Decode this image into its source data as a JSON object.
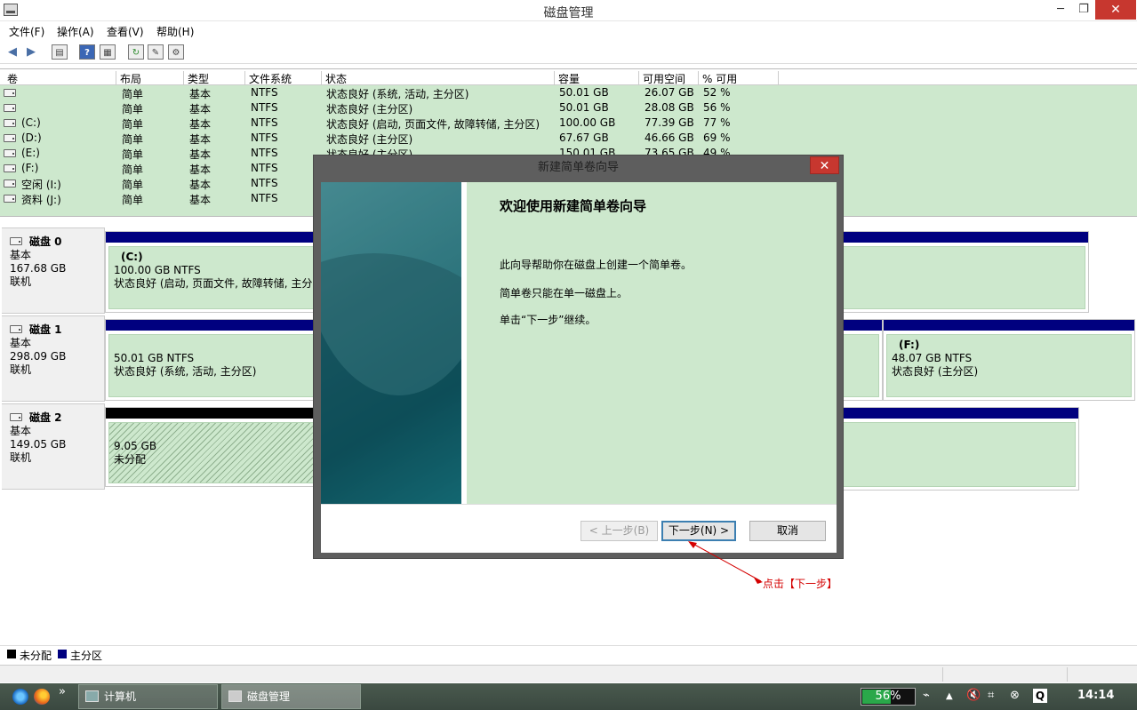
{
  "window": {
    "title": "磁盘管理",
    "min": "─",
    "max": "❐",
    "close": "✕"
  },
  "menu": [
    "文件(F)",
    "操作(A)",
    "查看(V)",
    "帮助(H)"
  ],
  "toolbar_icons": [
    "back-icon",
    "forward-icon",
    "properties-icon",
    "help-icon",
    "show-hide-icon",
    "refresh-icon",
    "export-icon",
    "settings-icon"
  ],
  "volume_list": {
    "columns": [
      "卷",
      "布局",
      "类型",
      "文件系统",
      "状态",
      "容量",
      "可用空间",
      "% 可用"
    ],
    "rows": [
      {
        "vol": "",
        "layout": "简单",
        "type": "基本",
        "fs": "NTFS",
        "status": "状态良好 (系统, 活动, 主分区)",
        "capacity": "50.01 GB",
        "free": "26.07 GB",
        "pct": "52 %"
      },
      {
        "vol": "",
        "layout": "简单",
        "type": "基本",
        "fs": "NTFS",
        "status": "状态良好 (主分区)",
        "capacity": "50.01 GB",
        "free": "28.08 GB",
        "pct": "56 %"
      },
      {
        "vol": "(C:)",
        "layout": "简单",
        "type": "基本",
        "fs": "NTFS",
        "status": "状态良好 (启动, 页面文件, 故障转储, 主分区)",
        "capacity": "100.00 GB",
        "free": "77.39 GB",
        "pct": "77 %"
      },
      {
        "vol": "(D:)",
        "layout": "简单",
        "type": "基本",
        "fs": "NTFS",
        "status": "状态良好 (主分区)",
        "capacity": "67.67 GB",
        "free": "46.66 GB",
        "pct": "69 %"
      },
      {
        "vol": "(E:)",
        "layout": "简单",
        "type": "基本",
        "fs": "NTFS",
        "status": "状态良好 (主分区)",
        "capacity": "150.01 GB",
        "free": "73.65 GB",
        "pct": "49 %"
      },
      {
        "vol": "(F:)",
        "layout": "简单",
        "type": "基本",
        "fs": "NTFS",
        "status": "",
        "capacity": "",
        "free": "",
        "pct": ""
      },
      {
        "vol": "空闲 (I:)",
        "layout": "简单",
        "type": "基本",
        "fs": "NTFS",
        "status": "",
        "capacity": "",
        "free": "",
        "pct": ""
      },
      {
        "vol": "资料 (J:)",
        "layout": "简单",
        "type": "基本",
        "fs": "NTFS",
        "status": "",
        "capacity": "",
        "free": "",
        "pct": ""
      }
    ]
  },
  "disks": [
    {
      "name": "磁盘 0",
      "kind": "基本",
      "size": "167.68 GB",
      "state": "联机",
      "partitions": [
        {
          "label": "(C:)",
          "size": "100.00 GB NTFS",
          "status": "状态良好 (启动, 页面文件, 故障转储, 主分区)",
          "bar": "primary"
        },
        {
          "label": "",
          "size": "",
          "status": "",
          "bar": "primary"
        }
      ]
    },
    {
      "name": "磁盘 1",
      "kind": "基本",
      "size": "298.09 GB",
      "state": "联机",
      "partitions": [
        {
          "label": "",
          "size": "50.01 GB NTFS",
          "status": "状态良好 (系统, 活动, 主分区)",
          "bar": "primary"
        },
        {
          "label": "",
          "size": "",
          "status": "",
          "bar": "primary"
        },
        {
          "label": "(F:)",
          "size": "48.07 GB NTFS",
          "status": "状态良好 (主分区)",
          "bar": "primary"
        }
      ]
    },
    {
      "name": "磁盘 2",
      "kind": "基本",
      "size": "149.05 GB",
      "state": "联机",
      "partitions": [
        {
          "label": "",
          "size": "9.05 GB",
          "status": "未分配",
          "bar": "unallocated"
        },
        {
          "label": "",
          "size": "",
          "status": "",
          "bar": "primary"
        }
      ]
    }
  ],
  "legend": [
    {
      "label": "未分配",
      "color": "#000000"
    },
    {
      "label": "主分区",
      "color": "#00007f"
    }
  ],
  "dialog": {
    "title": "新建简单卷向导",
    "close": "✕",
    "heading": "欢迎使用新建简单卷向导",
    "lines": [
      "此向导帮助你在磁盘上创建一个简单卷。",
      "简单卷只能在单一磁盘上。",
      "单击“下一步”继续。"
    ],
    "buttons": {
      "back": "< 上一步(B)",
      "next": "下一步(N) >",
      "cancel": "取消"
    }
  },
  "annotation": {
    "text": "点击【下一步】",
    "color": "#d40000"
  },
  "taskbar": {
    "overflow": "»",
    "items": [
      "计算机",
      "磁盘管理"
    ],
    "battery": "56%",
    "battery_level": 0.56,
    "clock": "14:14",
    "tray_icons": [
      "power-icon",
      "up-arrow-icon",
      "volume-muted-icon",
      "network-icon",
      "close-circle-icon",
      "q-icon"
    ]
  },
  "colors": {
    "volume_bg": "#cde8cd",
    "primary_bar": "#00007f",
    "unallocated_bar": "#000000",
    "close_red": "#c7372f"
  }
}
